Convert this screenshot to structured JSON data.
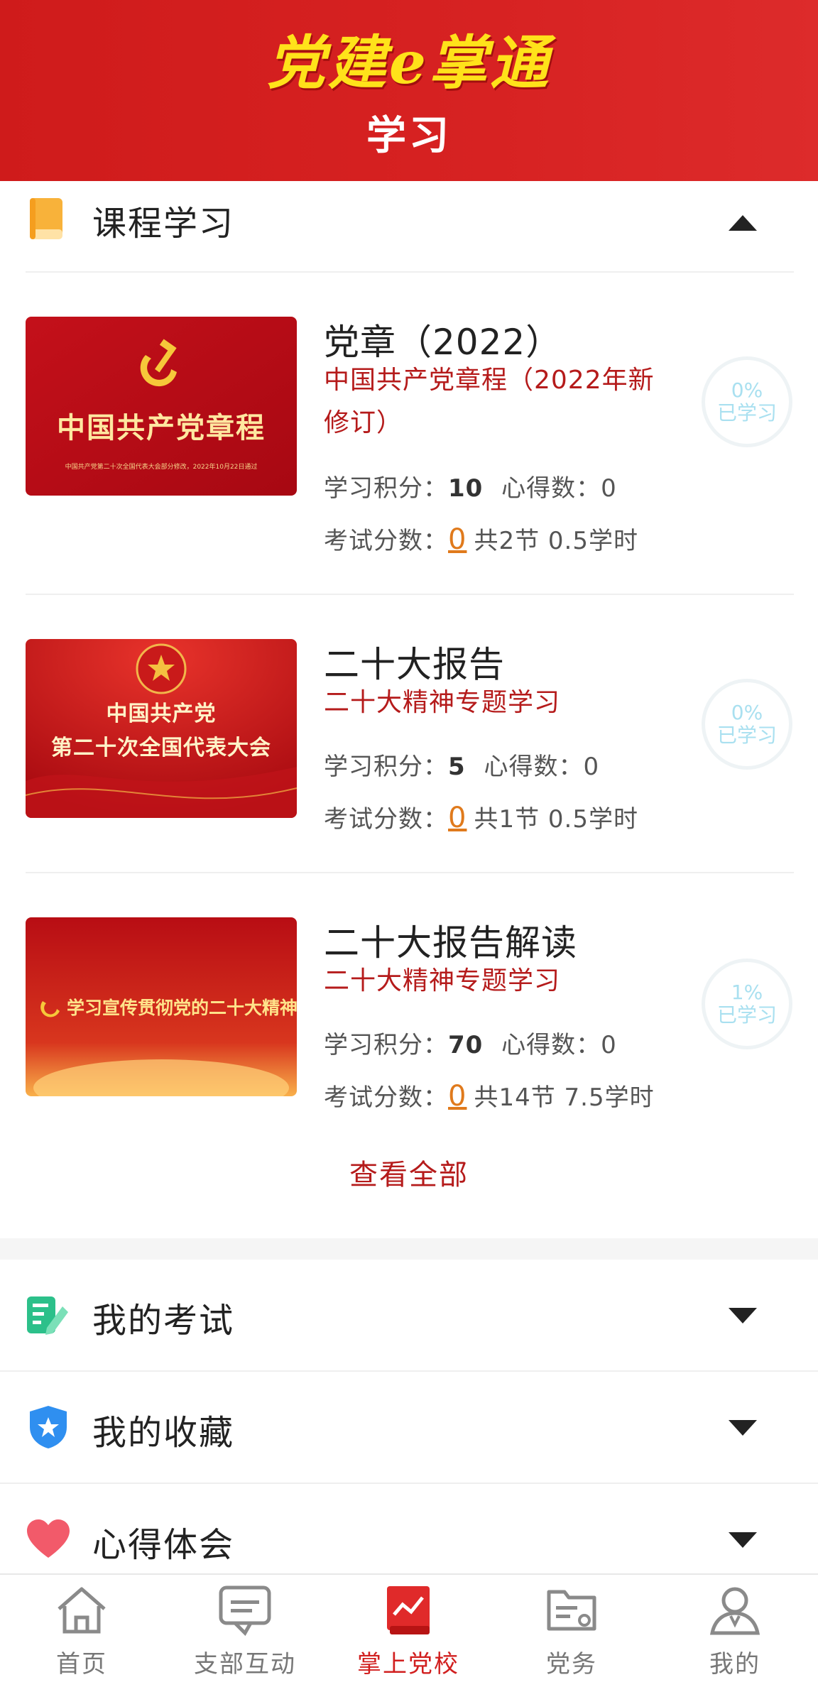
{
  "header": {
    "brand": "党建e掌通",
    "title": "学习"
  },
  "course_section": {
    "title": "课程学习",
    "courses": [
      {
        "title": "党章（2022）",
        "subtitle": "中国共产党章程（2022年新修订）",
        "thumb_text": "中国共产党章程",
        "thumb_caption": "中国共产党第二十次全国代表大会部分修改，2022年10月22日通过",
        "points_label": "学习积分：",
        "points": "10",
        "notes_label": "心得数：",
        "notes": "0",
        "exam_label": "考试分数：",
        "exam_score": "0",
        "summary": "共2节 0.5学时",
        "progress_pct": "0%",
        "progress_label": "已学习"
      },
      {
        "title": "二十大报告",
        "subtitle": "二十大精神专题学习",
        "thumb_text": "中国共产党",
        "thumb_text2": "第二十次全国代表大会",
        "points_label": "学习积分：",
        "points": "5",
        "notes_label": "心得数：",
        "notes": "0",
        "exam_label": "考试分数：",
        "exam_score": "0",
        "summary": "共1节 0.5学时",
        "progress_pct": "0%",
        "progress_label": "已学习"
      },
      {
        "title": "二十大报告解读",
        "subtitle": "二十大精神专题学习",
        "thumb_text": "学习宣传贯彻党的二十大精神",
        "points_label": "学习积分：",
        "points": "70",
        "notes_label": "心得数：",
        "notes": "0",
        "exam_label": "考试分数：",
        "exam_score": "0",
        "summary": "共14节 7.5学时",
        "progress_pct": "1%",
        "progress_label": "已学习"
      }
    ],
    "view_all": "查看全部"
  },
  "rows": {
    "exam": "我的考试",
    "favorites": "我的收藏",
    "insights": "心得体会"
  },
  "nav": {
    "home": "首页",
    "branch": "支部互动",
    "school": "掌上党校",
    "affairs": "党务",
    "mine": "我的"
  },
  "colors": {
    "brand_red": "#d11f1f",
    "accent_orange": "#e07a1c",
    "progress_text": "#a9e0f0"
  }
}
